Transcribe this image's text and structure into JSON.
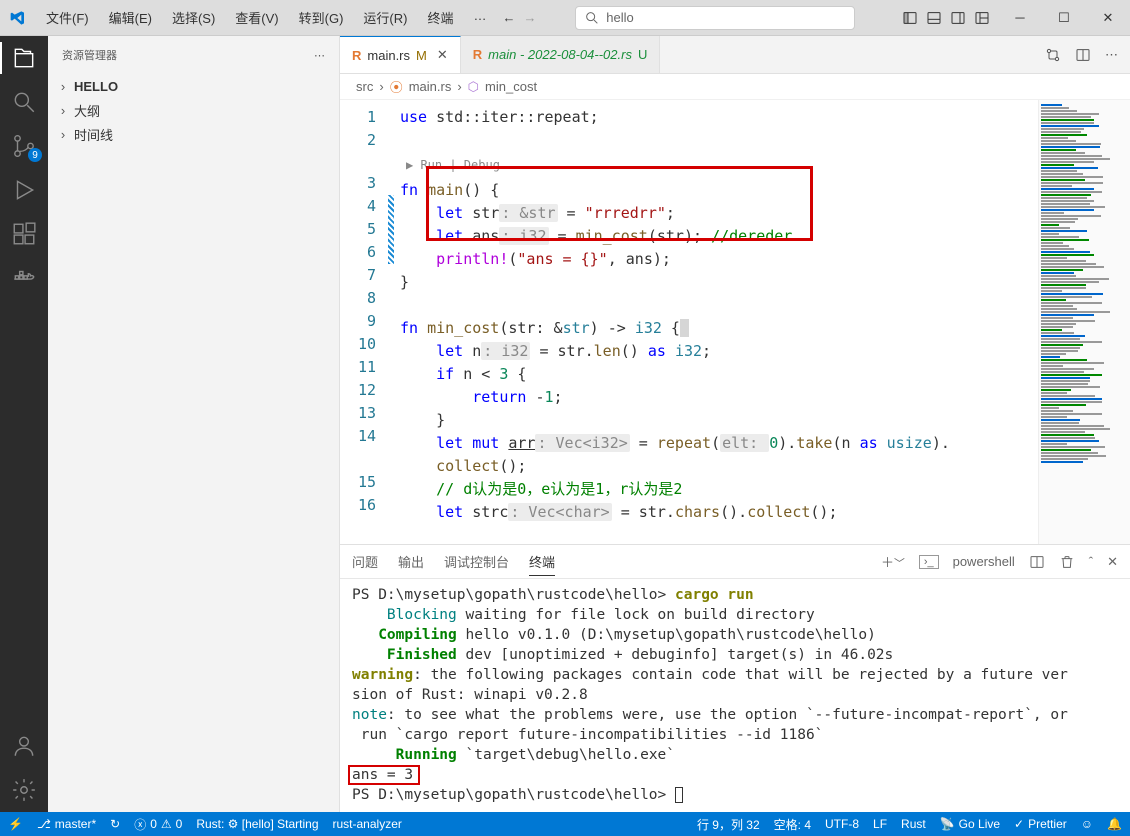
{
  "titlebar": {
    "menus": [
      "文件(F)",
      "编辑(E)",
      "选择(S)",
      "查看(V)",
      "转到(G)",
      "运行(R)",
      "终端",
      "…"
    ],
    "search_placeholder": "hello"
  },
  "activity": {
    "scm_badge": "9"
  },
  "sidebar": {
    "title": "资源管理器",
    "sections": [
      {
        "label": "HELLO",
        "bold": true
      },
      {
        "label": "大纲"
      },
      {
        "label": "时间线"
      }
    ]
  },
  "tabs": [
    {
      "icon": "R",
      "name": "main.rs",
      "suffix": "M",
      "active": true,
      "close": true,
      "italic": false
    },
    {
      "icon": "R",
      "name": "main - 2022-08-04--02.rs",
      "suffix": "U",
      "active": false,
      "close": false,
      "italic": true
    }
  ],
  "breadcrumb": [
    "src",
    "main.rs",
    "min_cost"
  ],
  "codelens": "Run | Debug",
  "code_lines": [
    {
      "n": 1,
      "mod": false,
      "html": "<span class='kw'>use</span> std::iter::repeat;"
    },
    {
      "n": 2,
      "mod": false,
      "html": ""
    },
    {
      "n": 3,
      "mod": false,
      "html": "<span class='kw'>fn</span> <span class='fn'>main</span>() {"
    },
    {
      "n": 4,
      "mod": true,
      "html": "    <span class='kw'>let</span> str<span class='gr'>: &str</span> = <span class='st'>\"rrredrr\"</span>;"
    },
    {
      "n": 5,
      "mod": true,
      "html": "    <span class='kw'>let</span> ans<span class='gr'>: i32</span> = <span class='fn'>min_cost</span>(str); <span class='cm'>//dereder</span>"
    },
    {
      "n": 6,
      "mod": true,
      "html": "    <span class='mc'>println!</span>(<span class='st'>\"ans = {}\"</span>, ans);"
    },
    {
      "n": 7,
      "mod": false,
      "html": "}"
    },
    {
      "n": 8,
      "mod": false,
      "html": ""
    },
    {
      "n": 9,
      "mod": false,
      "html": "<span class='kw'>fn</span> <span class='fn'>min_cost</span>(str: &<span class='ty'>str</span>) -> <span class='ty'>i32</span> {<span style='background:#d6d6d6'>&nbsp;</span>"
    },
    {
      "n": 10,
      "mod": false,
      "html": "    <span class='kw'>let</span> n<span class='gr'>: i32</span> = str.<span class='fn'>len</span>() <span class='kw'>as</span> <span class='ty'>i32</span>;"
    },
    {
      "n": 11,
      "mod": false,
      "html": "    <span class='kw'>if</span> n &lt; <span class='nm'>3</span> {"
    },
    {
      "n": 12,
      "mod": false,
      "html": "        <span class='kw'>return</span> -<span class='nm'>1</span>;"
    },
    {
      "n": 13,
      "mod": false,
      "html": "    }"
    },
    {
      "n": 14,
      "mod": false,
      "html": "    <span class='kw'>let</span> <span class='kw'>mut</span> <u>arr</u><span class='gr'>: Vec&lt;i32&gt;</span> = <span class='fn'>repeat</span>(<span class='gr'>elt: </span><span class='nm'>0</span>).<span class='fn'>take</span>(n <span class='kw'>as</span> <span class='ty'>usize</span>).\n    <span class='fn'>collect</span>();"
    },
    {
      "n": 15,
      "mod": false,
      "html": "    <span class='cm'>// d认为是0，e认为是1，r认为是2</span>"
    },
    {
      "n": 16,
      "mod": false,
      "html": "    <span class='kw'>let</span> strc<span class='gr'>: Vec&lt;char&gt;</span> = str.<span class='fn'>chars</span>().<span class='fn'>collect</span>();"
    }
  ],
  "panel": {
    "tabs": [
      "问题",
      "输出",
      "调试控制台",
      "终端"
    ],
    "active": 3,
    "shell": "powershell",
    "lines": [
      {
        "html": "PS D:\\mysetup\\gopath\\rustcode\\hello&gt; <span class='t-y'>cargo run</span>"
      },
      {
        "html": "    <span class='t-c'>Blocking</span> waiting for file lock on build directory"
      },
      {
        "html": "   <span class='t-g'>Compiling</span> hello v0.1.0 (D:\\mysetup\\gopath\\rustcode\\hello)"
      },
      {
        "html": "    <span class='t-g'>Finished</span> dev [unoptimized + debuginfo] target(s) in 46.02s"
      },
      {
        "html": "<span class='t-y'>warning</span>: the following packages contain code that will be rejected by a future ver"
      },
      {
        "html": "sion of Rust: winapi v0.2.8"
      },
      {
        "html": "<span class='t-c'>note</span>: to see what the problems were, use the option `--future-incompat-report`, or"
      },
      {
        "html": " run `cargo report future-incompatibilities --id 1186`"
      },
      {
        "html": "     <span class='t-g'>Running</span> `target\\debug\\hello.exe`"
      },
      {
        "html": "ans = 3"
      },
      {
        "html": "PS D:\\mysetup\\gopath\\rustcode\\hello&gt; <span class='cursor'></span>"
      }
    ]
  },
  "status": {
    "branch": "master*",
    "sync": "↻",
    "errors": "0",
    "warnings": "0",
    "rust": "Rust: ⚙ [hello] Starting",
    "analyzer": "rust-analyzer",
    "pos": "行 9，列 32",
    "spaces": "空格: 4",
    "enc": "UTF-8",
    "eol": "LF",
    "lang": "Rust",
    "live": "Go Live",
    "prettier": "Prettier",
    "feedback": "☺"
  }
}
